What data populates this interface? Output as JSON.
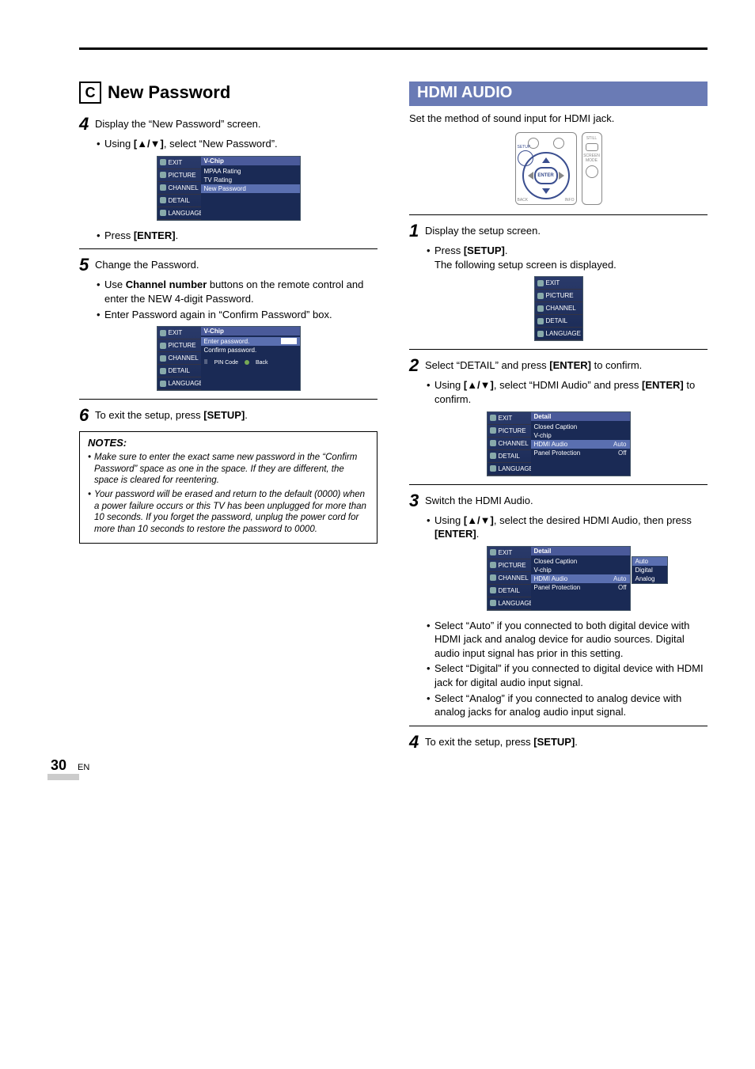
{
  "left": {
    "section_letter": "C",
    "section_title": "New Password",
    "step4": {
      "num": "4",
      "text_a": "Display the “New Password” screen.",
      "bullet_a_pre": "Using ",
      "bullet_a_key": "[▲/▼]",
      "bullet_a_post": ", select “New Password”.",
      "osd_title": "V-Chip",
      "osd_rows": [
        "MPAA Rating",
        "TV Rating",
        "New Password"
      ],
      "bullet_b_pre": "Press ",
      "bullet_b_key": "[ENTER]",
      "bullet_b_post": "."
    },
    "step5": {
      "num": "5",
      "text": "Change the Password.",
      "bullet_a_pre": "Use ",
      "bullet_a_key": "Channel number",
      "bullet_a_post": " buttons on the remote control and enter the NEW 4-digit Password.",
      "bullet_b": "Enter Password again in “Confirm Password” box.",
      "osd_title": "V-Chip",
      "osd_enter": "Enter password.",
      "osd_confirm": "Confirm password.",
      "osd_pin": "PIN Code",
      "osd_back": "Back"
    },
    "step6": {
      "num": "6",
      "text_pre": "To exit the setup, press ",
      "text_key": "[SETUP]",
      "text_post": "."
    },
    "notes_title": "NOTES:",
    "note1": "Make sure to enter the exact same new password in the “Confirm Password” space as one in the space. If they are different, the space is cleared for reentering.",
    "note2": "Your password will be erased and return to the default (0000) when a power failure occurs or this TV has been unplugged for more than 10 seconds. If you forget the password, unplug the power cord for more than 10 seconds to restore the password to 0000.",
    "menu_tabs": [
      "EXIT",
      "PICTURE",
      "CHANNEL",
      "DETAIL",
      "LANGUAGE"
    ]
  },
  "right": {
    "heading": "HDMI AUDIO",
    "intro": "Set the method of sound input for HDMI jack.",
    "remote": {
      "enter_label": "ENTER",
      "setup_label": "SETUP",
      "back_label": "BACK",
      "info_label": "INFO",
      "still_label": "STILL",
      "screen_label": "SCREEN MODE"
    },
    "step1": {
      "num": "1",
      "text": "Display the setup screen.",
      "bullet_pre": "Press ",
      "bullet_key": "[SETUP]",
      "bullet_post": ".",
      "sub": "The following setup screen is displayed.",
      "menu_tabs": [
        "EXIT",
        "PICTURE",
        "CHANNEL",
        "DETAIL",
        "LANGUAGE"
      ]
    },
    "step2": {
      "num": "2",
      "text_pre": "Select “DETAIL” and press ",
      "text_key": "[ENTER]",
      "text_post": " to confirm.",
      "bullet_pre": "Using ",
      "bullet_key1": "[▲/▼]",
      "bullet_mid": ", select “HDMI Audio” and press ",
      "bullet_key2": "[ENTER]",
      "bullet_post": " to confirm.",
      "osd_title": "Detail",
      "osd_rows": [
        {
          "l": "Closed Caption",
          "r": ""
        },
        {
          "l": "V-chip",
          "r": ""
        },
        {
          "l": "HDMI Audio",
          "r": "Auto",
          "sel": true
        },
        {
          "l": "Panel Protection",
          "r": "Off"
        }
      ]
    },
    "step3": {
      "num": "3",
      "text": "Switch the HDMI Audio.",
      "bullet_pre": "Using ",
      "bullet_key1": "[▲/▼]",
      "bullet_mid": ", select the desired HDMI Audio, then press ",
      "bullet_key2": "[ENTER]",
      "bullet_post": ".",
      "osd_title": "Detail",
      "osd_rows": [
        {
          "l": "Closed Caption",
          "r": ""
        },
        {
          "l": "V-chip",
          "r": ""
        },
        {
          "l": "HDMI Audio",
          "r": "Auto",
          "sel": true
        },
        {
          "l": "Panel Protection",
          "r": "Off"
        }
      ],
      "popup": [
        "Auto",
        "Digital",
        "Analog"
      ],
      "bullet_auto": "Select “Auto” if you connected to both digital device with HDMI jack and analog device for audio sources. Digital audio input signal has prior in this setting.",
      "bullet_digital": "Select “Digital” if you connected to digital device with HDMI jack for digital audio input signal.",
      "bullet_analog": "Select “Analog” if you connected to analog device with analog jacks for analog audio input signal."
    },
    "step4": {
      "num": "4",
      "text_pre": "To exit the setup, press ",
      "text_key": "[SETUP]",
      "text_post": "."
    }
  },
  "page_number": "30",
  "page_lang": "EN"
}
